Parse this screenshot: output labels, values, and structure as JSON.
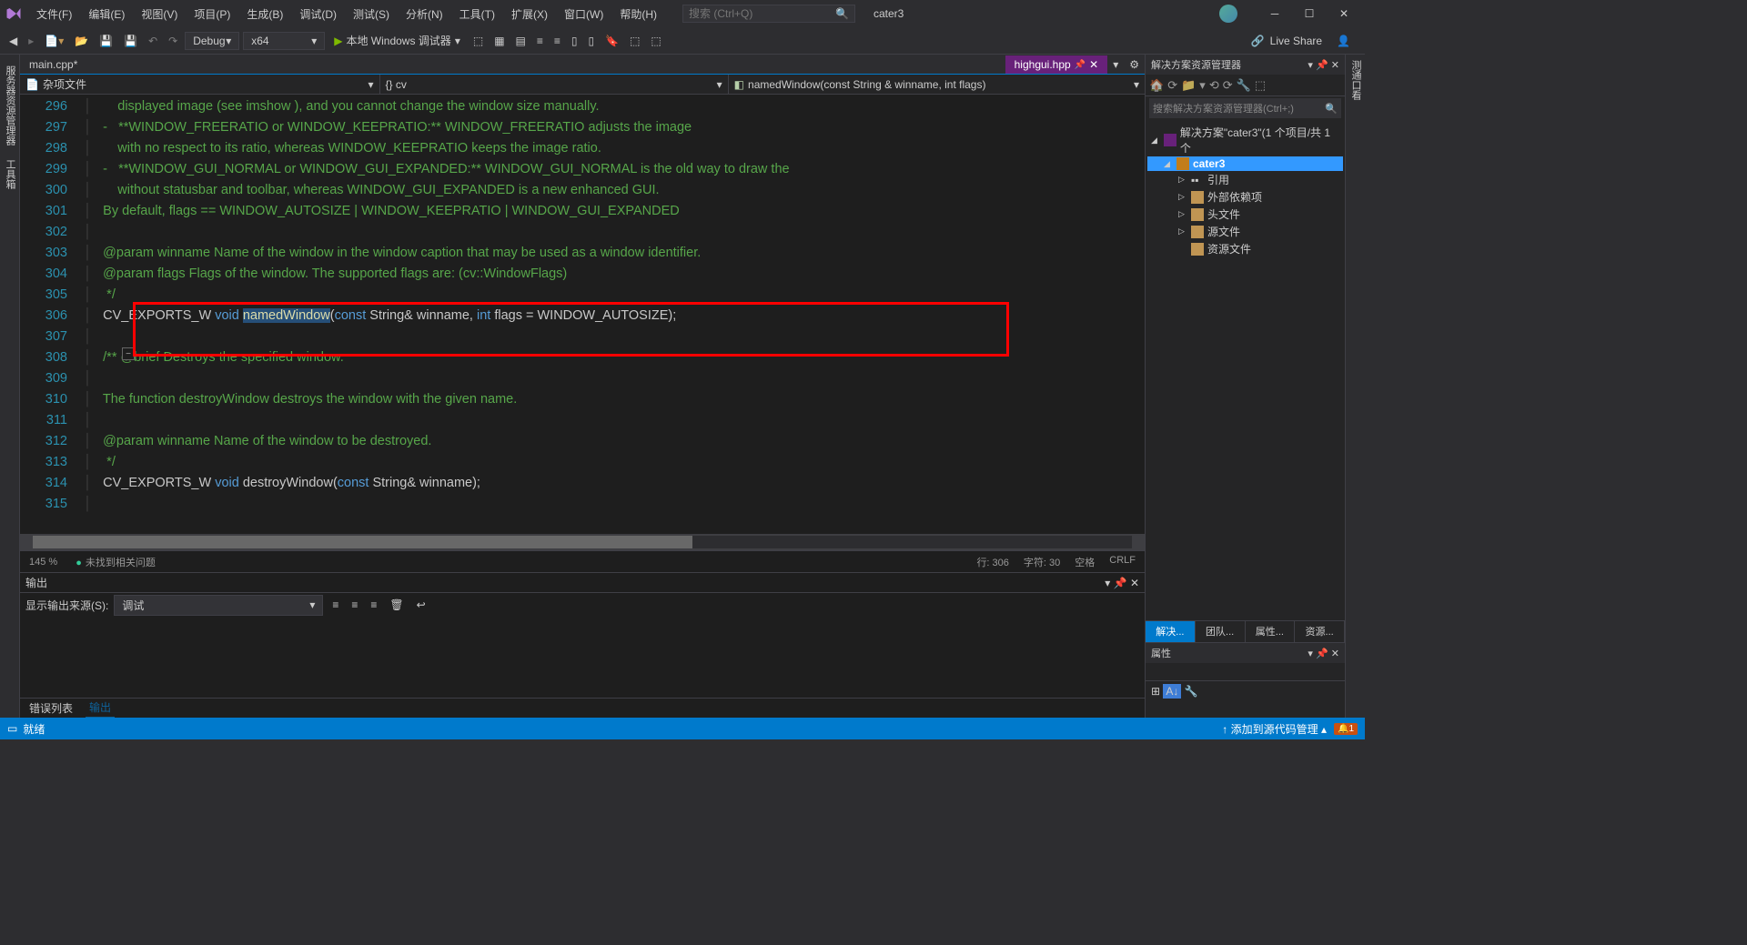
{
  "title": {
    "project": "cater3"
  },
  "menus": [
    "文件(F)",
    "编辑(E)",
    "视图(V)",
    "项目(P)",
    "生成(B)",
    "调试(D)",
    "测试(S)",
    "分析(N)",
    "工具(T)",
    "扩展(X)",
    "窗口(W)",
    "帮助(H)"
  ],
  "search_placeholder": "搜索 (Ctrl+Q)",
  "toolbar": {
    "config": "Debug",
    "platform": "x64",
    "start": "本地 Windows 调试器",
    "liveshare": "Live Share"
  },
  "leftStrip": [
    "服务器资源管理器",
    "工具箱"
  ],
  "rightStrip": [
    "测通口看"
  ],
  "tabs": {
    "left": "main.cpp*",
    "right": "highgui.hpp"
  },
  "navbar": {
    "a": "杂项文件",
    "b": "{} cv",
    "c": "namedWindow(const String & winname, int flags)"
  },
  "code": [
    {
      "n": 296,
      "html": "    displayed image (see imshow ), and you cannot change the window size manually."
    },
    {
      "n": 297,
      "html": "-   **WINDOW_FREERATIO or WINDOW_KEEPRATIO:** WINDOW_FREERATIO adjusts the image"
    },
    {
      "n": 298,
      "html": "    with no respect to its ratio, whereas WINDOW_KEEPRATIO keeps the image ratio."
    },
    {
      "n": 299,
      "html": "-   **WINDOW_GUI_NORMAL or WINDOW_GUI_EXPANDED:** WINDOW_GUI_NORMAL is the old way to draw the "
    },
    {
      "n": 300,
      "html": "    without statusbar and toolbar, whereas WINDOW_GUI_EXPANDED is a new enhanced GUI."
    },
    {
      "n": 301,
      "html": "By default, flags == WINDOW_AUTOSIZE | WINDOW_KEEPRATIO | WINDOW_GUI_EXPANDED"
    },
    {
      "n": 302,
      "html": ""
    },
    {
      "n": 303,
      "html": "@param winname Name of the window in the window caption that may be used as a window identifier."
    },
    {
      "n": 304,
      "html": "@param flags Flags of the window. The supported flags are: (cv::WindowFlags)"
    },
    {
      "n": 305,
      "html": " */"
    },
    {
      "n": 306,
      "html": "<span class='pl'>CV_EXPORTS_W </span><span class='kw'>void </span><span class='sel'>namedWindow</span><span class='pl'>(</span><span class='kw'>const</span><span class='pl'> String&amp; winname, </span><span class='kw'>int</span><span class='pl'> flags = WINDOW_AUTOSIZE);</span>"
    },
    {
      "n": 307,
      "html": ""
    },
    {
      "n": 308,
      "html": "/** @brief Destroys the specified window.",
      "fold": true
    },
    {
      "n": 309,
      "html": ""
    },
    {
      "n": 310,
      "html": "The function destroyWindow destroys the window with the given name."
    },
    {
      "n": 311,
      "html": ""
    },
    {
      "n": 312,
      "html": "@param winname Name of the window to be destroyed."
    },
    {
      "n": 313,
      "html": " */"
    },
    {
      "n": 314,
      "html": "<span class='pl'>CV_EXPORTS_W </span><span class='kw'>void</span><span class='pl'> destroyWindow(</span><span class='kw'>const</span><span class='pl'> String&amp; winname);</span>"
    },
    {
      "n": 315,
      "html": ""
    }
  ],
  "editorStatus": {
    "zoom": "145 %",
    "issues": "未找到相关问题",
    "line": "行: 306",
    "col": "字符: 30",
    "ins": "空格",
    "eol": "CRLF"
  },
  "output": {
    "title": "输出",
    "sourceLabel": "显示输出来源(S):",
    "source": "调试",
    "tabs": [
      "错误列表",
      "输出"
    ]
  },
  "solution": {
    "title": "解决方案资源管理器",
    "search": "搜索解决方案资源管理器(Ctrl+;)",
    "root": "解决方案\"cater3\"(1 个项目/共 1 个",
    "project": "cater3",
    "nodes": [
      "引用",
      "外部依赖项",
      "头文件",
      "源文件",
      "资源文件"
    ],
    "bottomTabs": [
      "解决...",
      "团队...",
      "属性...",
      "资源..."
    ]
  },
  "props": {
    "title": "属性"
  },
  "statusbar": {
    "ready": "就绪",
    "scm": "添加到源代码管理",
    "notif": "1"
  }
}
